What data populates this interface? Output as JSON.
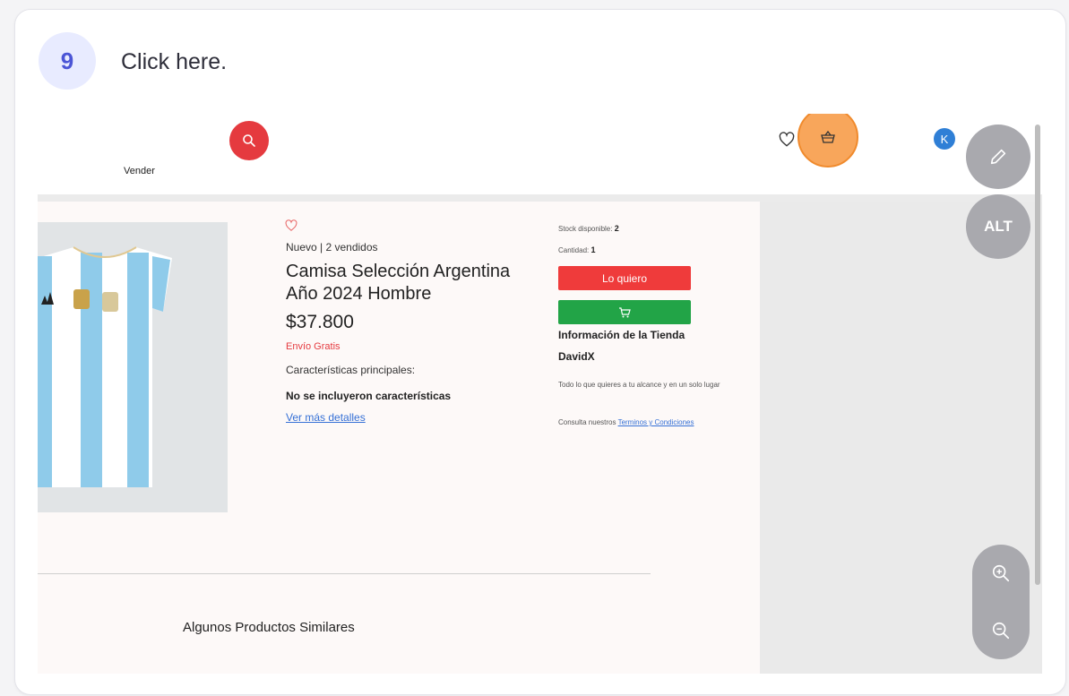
{
  "step": {
    "number": "9",
    "instruction": "Click here."
  },
  "header": {
    "vender_label": "Vender"
  },
  "avatar": {
    "initial": "K"
  },
  "product": {
    "condition": "Nuevo | 2 vendidos",
    "title": "Camisa Selección Argentina Año 2024 Hombre",
    "price": "$37.800",
    "shipping": "Envío Gratis",
    "features_heading": "Características principales:",
    "no_features": "No se incluyeron características",
    "more_details": "Ver más detalles"
  },
  "purchase": {
    "stock_label": "Stock disponible:",
    "stock_value": "2",
    "qty_label": "Cantidad:",
    "qty_value": "1",
    "buy_label": "Lo quiero"
  },
  "store": {
    "heading": "Información de la Tienda",
    "name": "DavidX",
    "description": "Todo lo que quieres a tu alcance y en un solo lugar",
    "terms_prefix": "Consulta nuestros",
    "terms_link": "Terminos y Condiciones"
  },
  "similar_heading": "Algunos Productos Similares",
  "controls": {
    "alt_label": "ALT"
  },
  "colors": {
    "accent_badge": "#4b55d6",
    "search_red": "#e53a3f",
    "buy_red": "#ef3b3b",
    "cart_green": "#22a447",
    "highlight_orange": "#f8a65b"
  }
}
